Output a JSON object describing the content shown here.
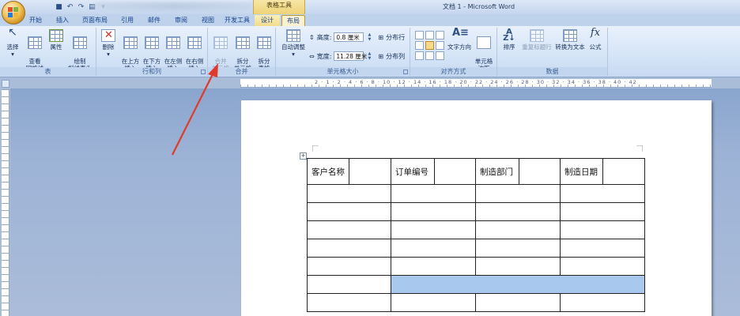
{
  "window": {
    "title": "文档 1 - Microsoft Word",
    "context_group": "表格工具"
  },
  "tabs": [
    {
      "label": "开始"
    },
    {
      "label": "插入"
    },
    {
      "label": "页面布局"
    },
    {
      "label": "引用"
    },
    {
      "label": "邮件"
    },
    {
      "label": "审阅"
    },
    {
      "label": "视图"
    },
    {
      "label": "开发工具"
    },
    {
      "label": "设计"
    },
    {
      "label": "布局"
    }
  ],
  "ribbon": {
    "table": {
      "label": "表",
      "select": "选择",
      "gridlines": "查看\n网格线",
      "properties": "属性",
      "draw_diagonal": "绘制\n斜线表头"
    },
    "rows_columns": {
      "label": "行和列",
      "delete": "删除",
      "insert_above": "在上方\n插入",
      "insert_below": "在下方\n插入",
      "insert_left": "在左侧\n插入",
      "insert_right": "在右侧\n插入"
    },
    "merge": {
      "label": "合并",
      "merge_cells": "合并\n单元格",
      "split_cells": "拆分\n单元格",
      "split_table": "拆分\n表格"
    },
    "cell_size": {
      "label": "单元格大小",
      "autofit": "自动调整",
      "height_label": "高度:",
      "height_value": "0.8 厘米",
      "width_label": "宽度:",
      "width_value": "11.28 厘米",
      "distribute_rows": "分布行",
      "distribute_cols": "分布列"
    },
    "alignment": {
      "label": "对齐方式",
      "text_direction": "文字方向",
      "cell_margins": "单元格\n边距"
    },
    "data": {
      "label": "数据",
      "sort": "排序",
      "repeat_header": "重复标题行",
      "convert_to_text": "转换为文本",
      "formula": "公式"
    }
  },
  "ruler": {
    "marks": "2 · 1 · 2 · 4 · 6 · 8 · 10 · 12 · 14 · 16 · 18 · 20 · 22 · 24 · 26 · 28 · 30 · 32 · 34 · 36 · 38 · 40 · 42"
  },
  "document": {
    "table_headers": [
      "客户名称",
      "",
      "订单编号",
      "",
      "制造部门",
      "",
      "制造日期",
      ""
    ]
  },
  "colors": {
    "annotation_arrow": "#e03a2e",
    "selection": "#a9c8ee"
  }
}
